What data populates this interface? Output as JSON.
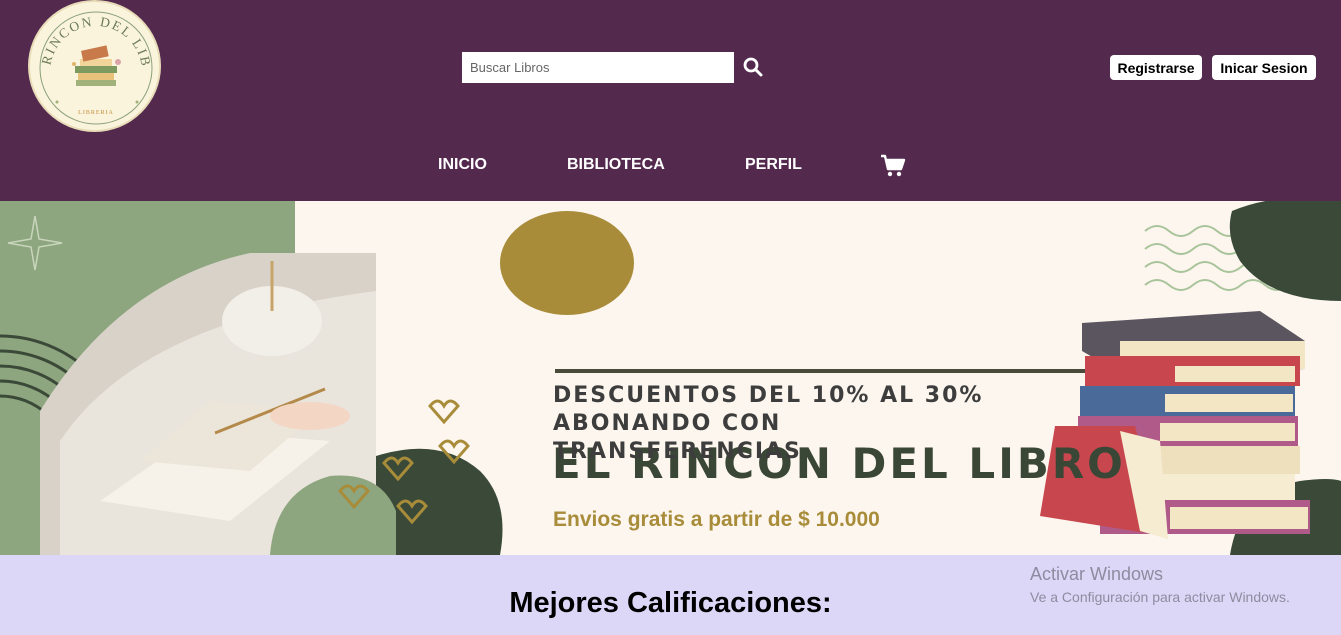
{
  "logo": {
    "title_text": "EL RINCON DEL LIBRO",
    "subtitle_text": "LIBRERIA",
    "icon": "book-stack-icon"
  },
  "search": {
    "placeholder": "Buscar Libros",
    "icon": "search-icon"
  },
  "auth": {
    "register_label": "Registrarse",
    "login_label": "Inicar Sesion"
  },
  "nav": {
    "items": [
      {
        "label": "INICIO"
      },
      {
        "label": "BIBLIOTECA"
      },
      {
        "label": "PERFIL"
      }
    ],
    "cart_icon": "cart-icon"
  },
  "banner": {
    "title_part1": "EL",
    "title_part2": "RINCON DEL LIBRO",
    "promo_lines": [
      "DESCUENTOS DEL 10% AL 30%",
      "ABONANDO CON",
      "TRANSFERENCIAS"
    ],
    "shipping": "Envios gratis a partir de $ 10.000"
  },
  "section": {
    "title": "Mejores Calificaciones:"
  },
  "windows_watermark": {
    "title": "Activar Windows",
    "subtitle": "Ve a Configuración para activar Windows."
  },
  "colors": {
    "header_bg": "#53294e",
    "page_bg": "#dcd7f7",
    "banner_bg": "#fcf6ee",
    "accent_gold": "#a88c3a",
    "sage": "#8ea67f",
    "dark_green": "#3b4a38"
  }
}
